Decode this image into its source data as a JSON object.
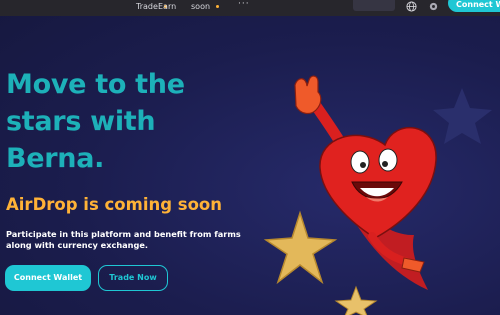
{
  "nav": {
    "items": [
      {
        "label": "Trade",
        "has_dot": true
      },
      {
        "label": "Earn",
        "has_dot": false
      },
      {
        "label": "soon",
        "has_dot": true
      }
    ],
    "more_label": "···",
    "connect_label": "Connect W"
  },
  "hero": {
    "title": "Move to the stars with Berna.",
    "subtitle": "AirDrop is coming soon",
    "description": "Participate in this platform and benefit from farms along with currency exchange.",
    "connect_button": "Connect Wallet",
    "trade_button": "Trade Now"
  },
  "colors": {
    "accent": "#1fc7d4",
    "title": "#1db1b9",
    "highlight": "#ffb237",
    "background": "#1c1f52",
    "topbar": "#27262c"
  },
  "icons": [
    "logo-hearts-icon",
    "globe-icon",
    "gear-icon",
    "mascot-heart-illustration",
    "star-icon"
  ]
}
